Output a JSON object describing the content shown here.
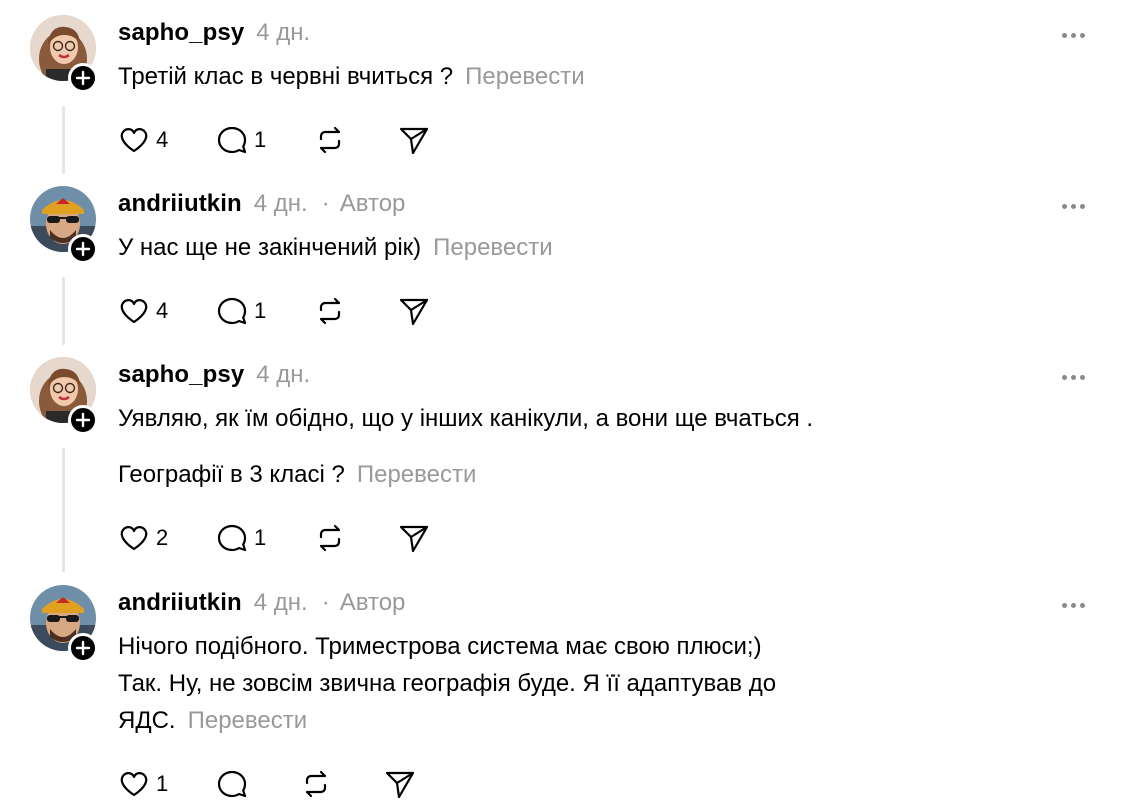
{
  "posts": [
    {
      "username": "sapho_psy",
      "time": "4 дн.",
      "author_badge": "",
      "lines": [
        "Третій клас в червні вчиться ?"
      ],
      "paragraph2": "",
      "translate": "Перевести",
      "likes": "4",
      "replies": "1",
      "avatar": "woman-with-glasses"
    },
    {
      "username": "andriiutkin",
      "time": "4 дн.",
      "separator": "·",
      "author_badge": "Автор",
      "lines": [
        "У нас ще не закінчений рік)"
      ],
      "translate": "Перевести",
      "likes": "4",
      "replies": "1",
      "avatar": "man-with-sunglasses-cap"
    },
    {
      "username": "sapho_psy",
      "time": "4 дн.",
      "author_badge": "",
      "line1": "Уявляю, як їм обідно, що у інших канікули, а вони ще вчаться .",
      "line2": "Географії в 3 класі ?",
      "translate": "Перевести",
      "likes": "2",
      "replies": "1",
      "avatar": "woman-with-glasses"
    },
    {
      "username": "andriiutkin",
      "time": "4 дн.",
      "separator": "·",
      "author_badge": "Автор",
      "line1": "Нічого подібного. Триместрова система має свою плюси;)",
      "line2": "Так. Ну, не зовсім звична географія буде. Я її адаптував до",
      "line3": "ЯДС.",
      "translate": "Перевести",
      "likes": "1",
      "replies": "",
      "avatar": "man-with-sunglasses-cap"
    }
  ],
  "icons": {
    "like": "heart-icon",
    "reply": "comment-icon",
    "repost": "repost-icon",
    "share": "send-icon",
    "more": "more-icon",
    "follow": "plus-icon"
  }
}
